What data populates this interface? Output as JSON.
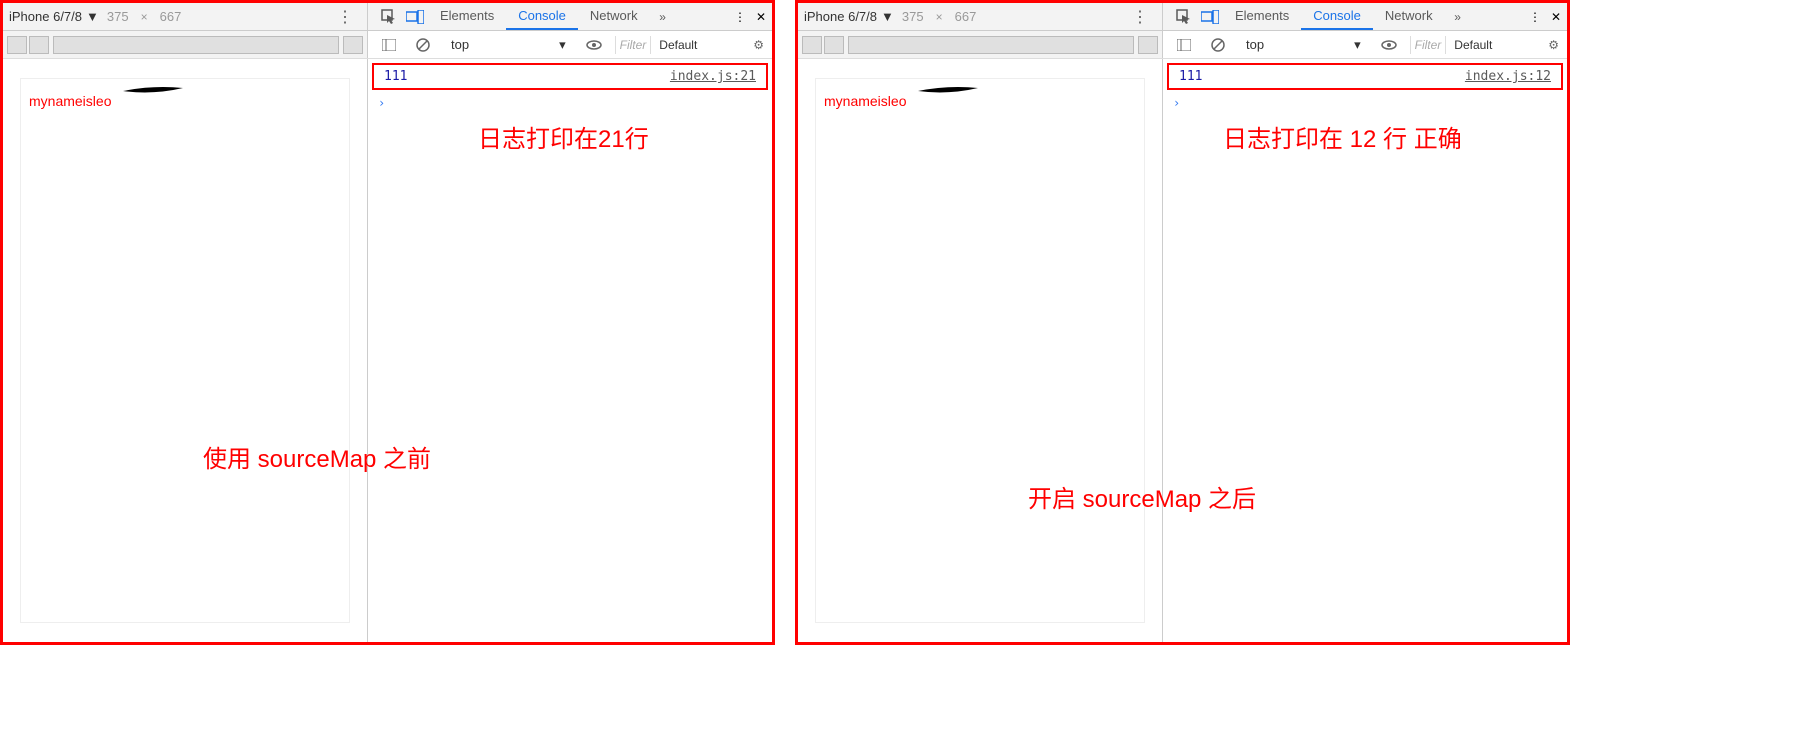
{
  "left": {
    "device": {
      "name": "iPhone 6/7/8",
      "width": "375",
      "height": "667"
    },
    "tabs": {
      "elements": "Elements",
      "console": "Console",
      "network": "Network"
    },
    "console_toolbar": {
      "context": "top",
      "filter_placeholder": "Filter",
      "level": "Default"
    },
    "log": {
      "value": "111",
      "source": "index.js:21"
    },
    "preview_text": "mynameisleo",
    "annotations": {
      "line": "日志打印在21行",
      "caption": "使用 sourceMap 之前"
    }
  },
  "right": {
    "device": {
      "name": "iPhone 6/7/8",
      "width": "375",
      "height": "667"
    },
    "tabs": {
      "elements": "Elements",
      "console": "Console",
      "network": "Network"
    },
    "console_toolbar": {
      "context": "top",
      "filter_placeholder": "Filter",
      "level": "Default"
    },
    "log": {
      "value": "111",
      "source": "index.js:12"
    },
    "preview_text": "mynameisleo",
    "annotations": {
      "line": "日志打印在 12 行 正确",
      "caption": "开启 sourceMap 之后"
    }
  }
}
